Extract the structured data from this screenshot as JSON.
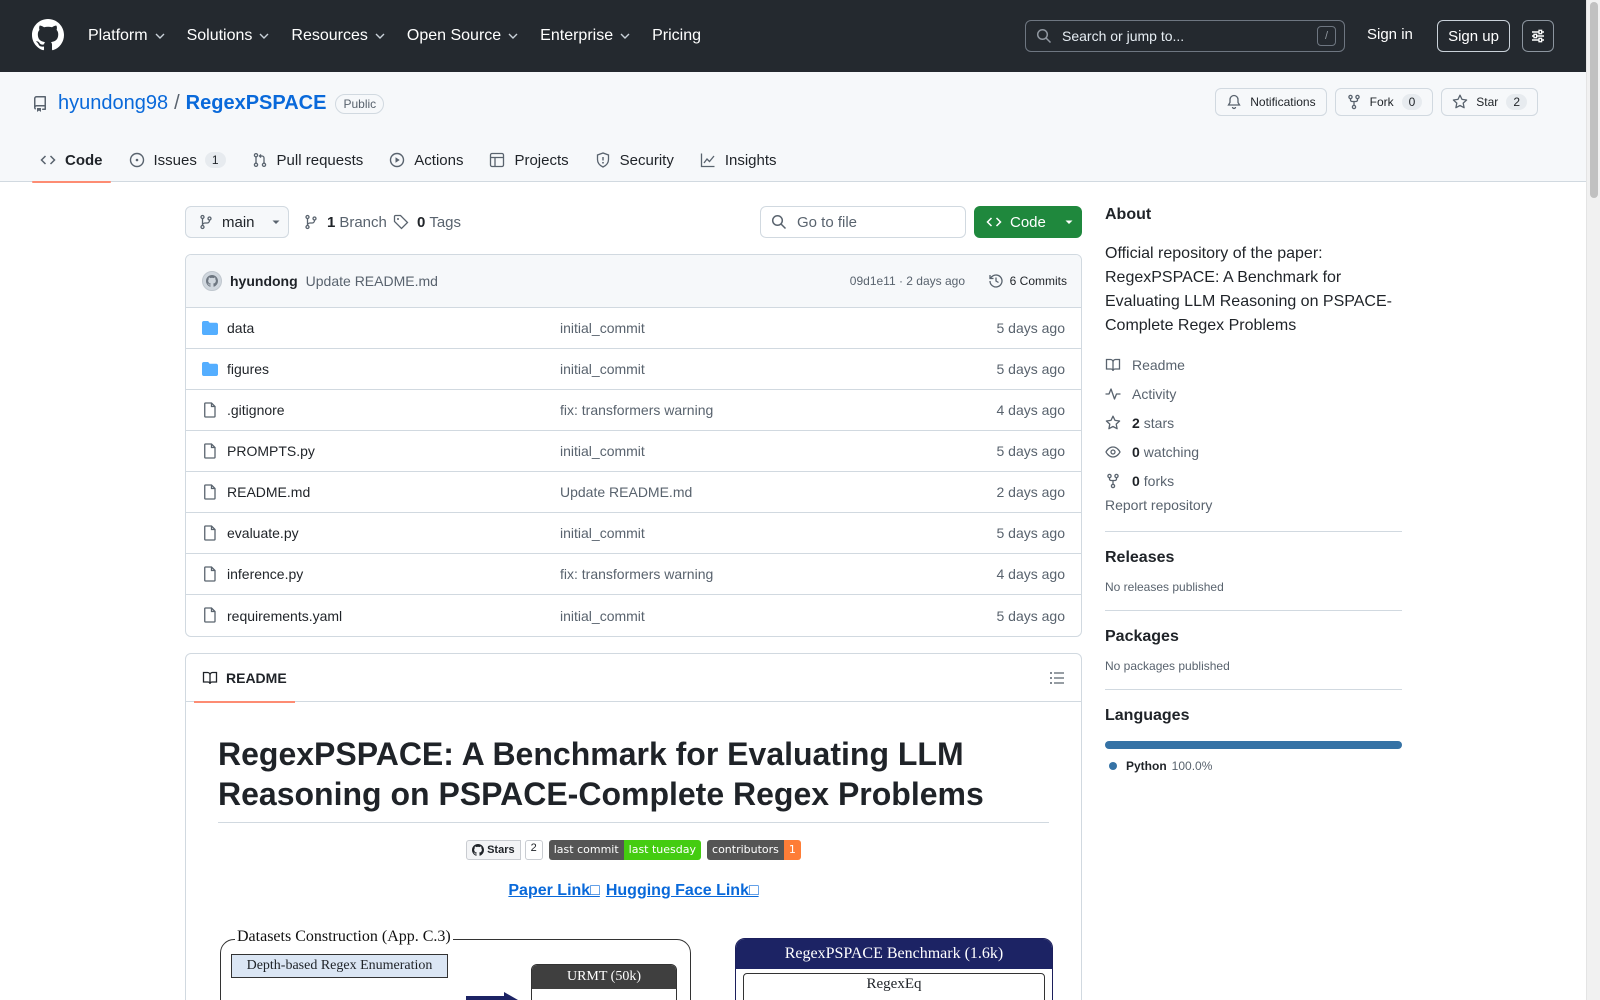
{
  "header": {
    "nav": [
      {
        "label": "Platform"
      },
      {
        "label": "Solutions"
      },
      {
        "label": "Resources"
      },
      {
        "label": "Open Source"
      },
      {
        "label": "Enterprise"
      },
      {
        "label": "Pricing"
      }
    ],
    "search_placeholder": "Search or jump to...",
    "search_shortcut": "/",
    "sign_in": "Sign in",
    "sign_up": "Sign up"
  },
  "repo": {
    "owner": "hyundong98",
    "separator": "/",
    "name": "RegexPSPACE",
    "visibility": "Public",
    "notifications_label": "Notifications",
    "fork_label": "Fork",
    "fork_count": "0",
    "star_label": "Star",
    "star_count": "2",
    "tabs": [
      {
        "label": "Code",
        "icon": "code-icon",
        "active": true
      },
      {
        "label": "Issues",
        "icon": "issue-opened-icon",
        "count": "1"
      },
      {
        "label": "Pull requests",
        "icon": "git-pull-request-icon"
      },
      {
        "label": "Actions",
        "icon": "play-icon"
      },
      {
        "label": "Projects",
        "icon": "table-icon"
      },
      {
        "label": "Security",
        "icon": "shield-icon"
      },
      {
        "label": "Insights",
        "icon": "graph-icon"
      }
    ]
  },
  "toolbar": {
    "branch": "main",
    "branch_count": "1",
    "branch_label": "Branch",
    "tag_count": "0",
    "tag_label": "Tags",
    "goto_placeholder": "Go to file",
    "code_button": "Code"
  },
  "latest_commit": {
    "author": "hyundong",
    "message": "Update README.md",
    "meta": "09d1e11 · 2 days ago",
    "commits": "6 Commits"
  },
  "files": [
    {
      "type": "folder",
      "name": "data",
      "message": "initial_commit",
      "date": "5 days ago"
    },
    {
      "type": "folder",
      "name": "figures",
      "message": "initial_commit",
      "date": "5 days ago"
    },
    {
      "type": "file",
      "name": ".gitignore",
      "message": "fix: transformers warning",
      "date": "4 days ago"
    },
    {
      "type": "file",
      "name": "PROMPTS.py",
      "message": "initial_commit",
      "date": "5 days ago"
    },
    {
      "type": "file",
      "name": "README.md",
      "message": "Update README.md",
      "date": "2 days ago"
    },
    {
      "type": "file",
      "name": "evaluate.py",
      "message": "initial_commit",
      "date": "5 days ago"
    },
    {
      "type": "file",
      "name": "inference.py",
      "message": "fix: transformers warning",
      "date": "4 days ago"
    },
    {
      "type": "file",
      "name": "requirements.yaml",
      "message": "initial_commit",
      "date": "5 days ago"
    }
  ],
  "readme": {
    "tab_label": "README",
    "title": "RegexPSPACE: A Benchmark for Evaluating LLM Reasoning on PSPACE-Complete Regex Problems",
    "badge_stars_label": "Stars",
    "badge_stars_count": "2",
    "badge_commit_left": "last commit",
    "badge_commit_right": "last tuesday",
    "badge_commit_color": "#4c1",
    "badge_contrib_left": "contributors",
    "badge_contrib_right": "1",
    "badge_contrib_color": "#fe7d37",
    "paper_link": "Paper Link□",
    "hf_link": "Hugging Face Link□",
    "figure": {
      "left_title": "Datasets Construction (App. C.3)",
      "left_box": "Depth-based Regex Enumeration",
      "urmt_label": "URMT (50k)",
      "right_title": "RegexPSPACE Benchmark (1.6k)",
      "right_sub": "RegexEq"
    }
  },
  "sidebar": {
    "about_title": "About",
    "about_desc": "Official repository of the paper: RegexPSPACE: A Benchmark for Evaluating LLM Reasoning on PSPACE-Complete Regex Problems",
    "readme": "Readme",
    "activity": "Activity",
    "stars_count": "2",
    "stars_label": "stars",
    "watching_count": "0",
    "watching_label": "watching",
    "forks_count": "0",
    "forks_label": "forks",
    "report": "Report repository",
    "releases_title": "Releases",
    "releases_text": "No releases published",
    "packages_title": "Packages",
    "packages_text": "No packages published",
    "languages_title": "Languages",
    "language_name": "Python",
    "language_pct": "100.0%",
    "language_color": "#3572A5"
  }
}
